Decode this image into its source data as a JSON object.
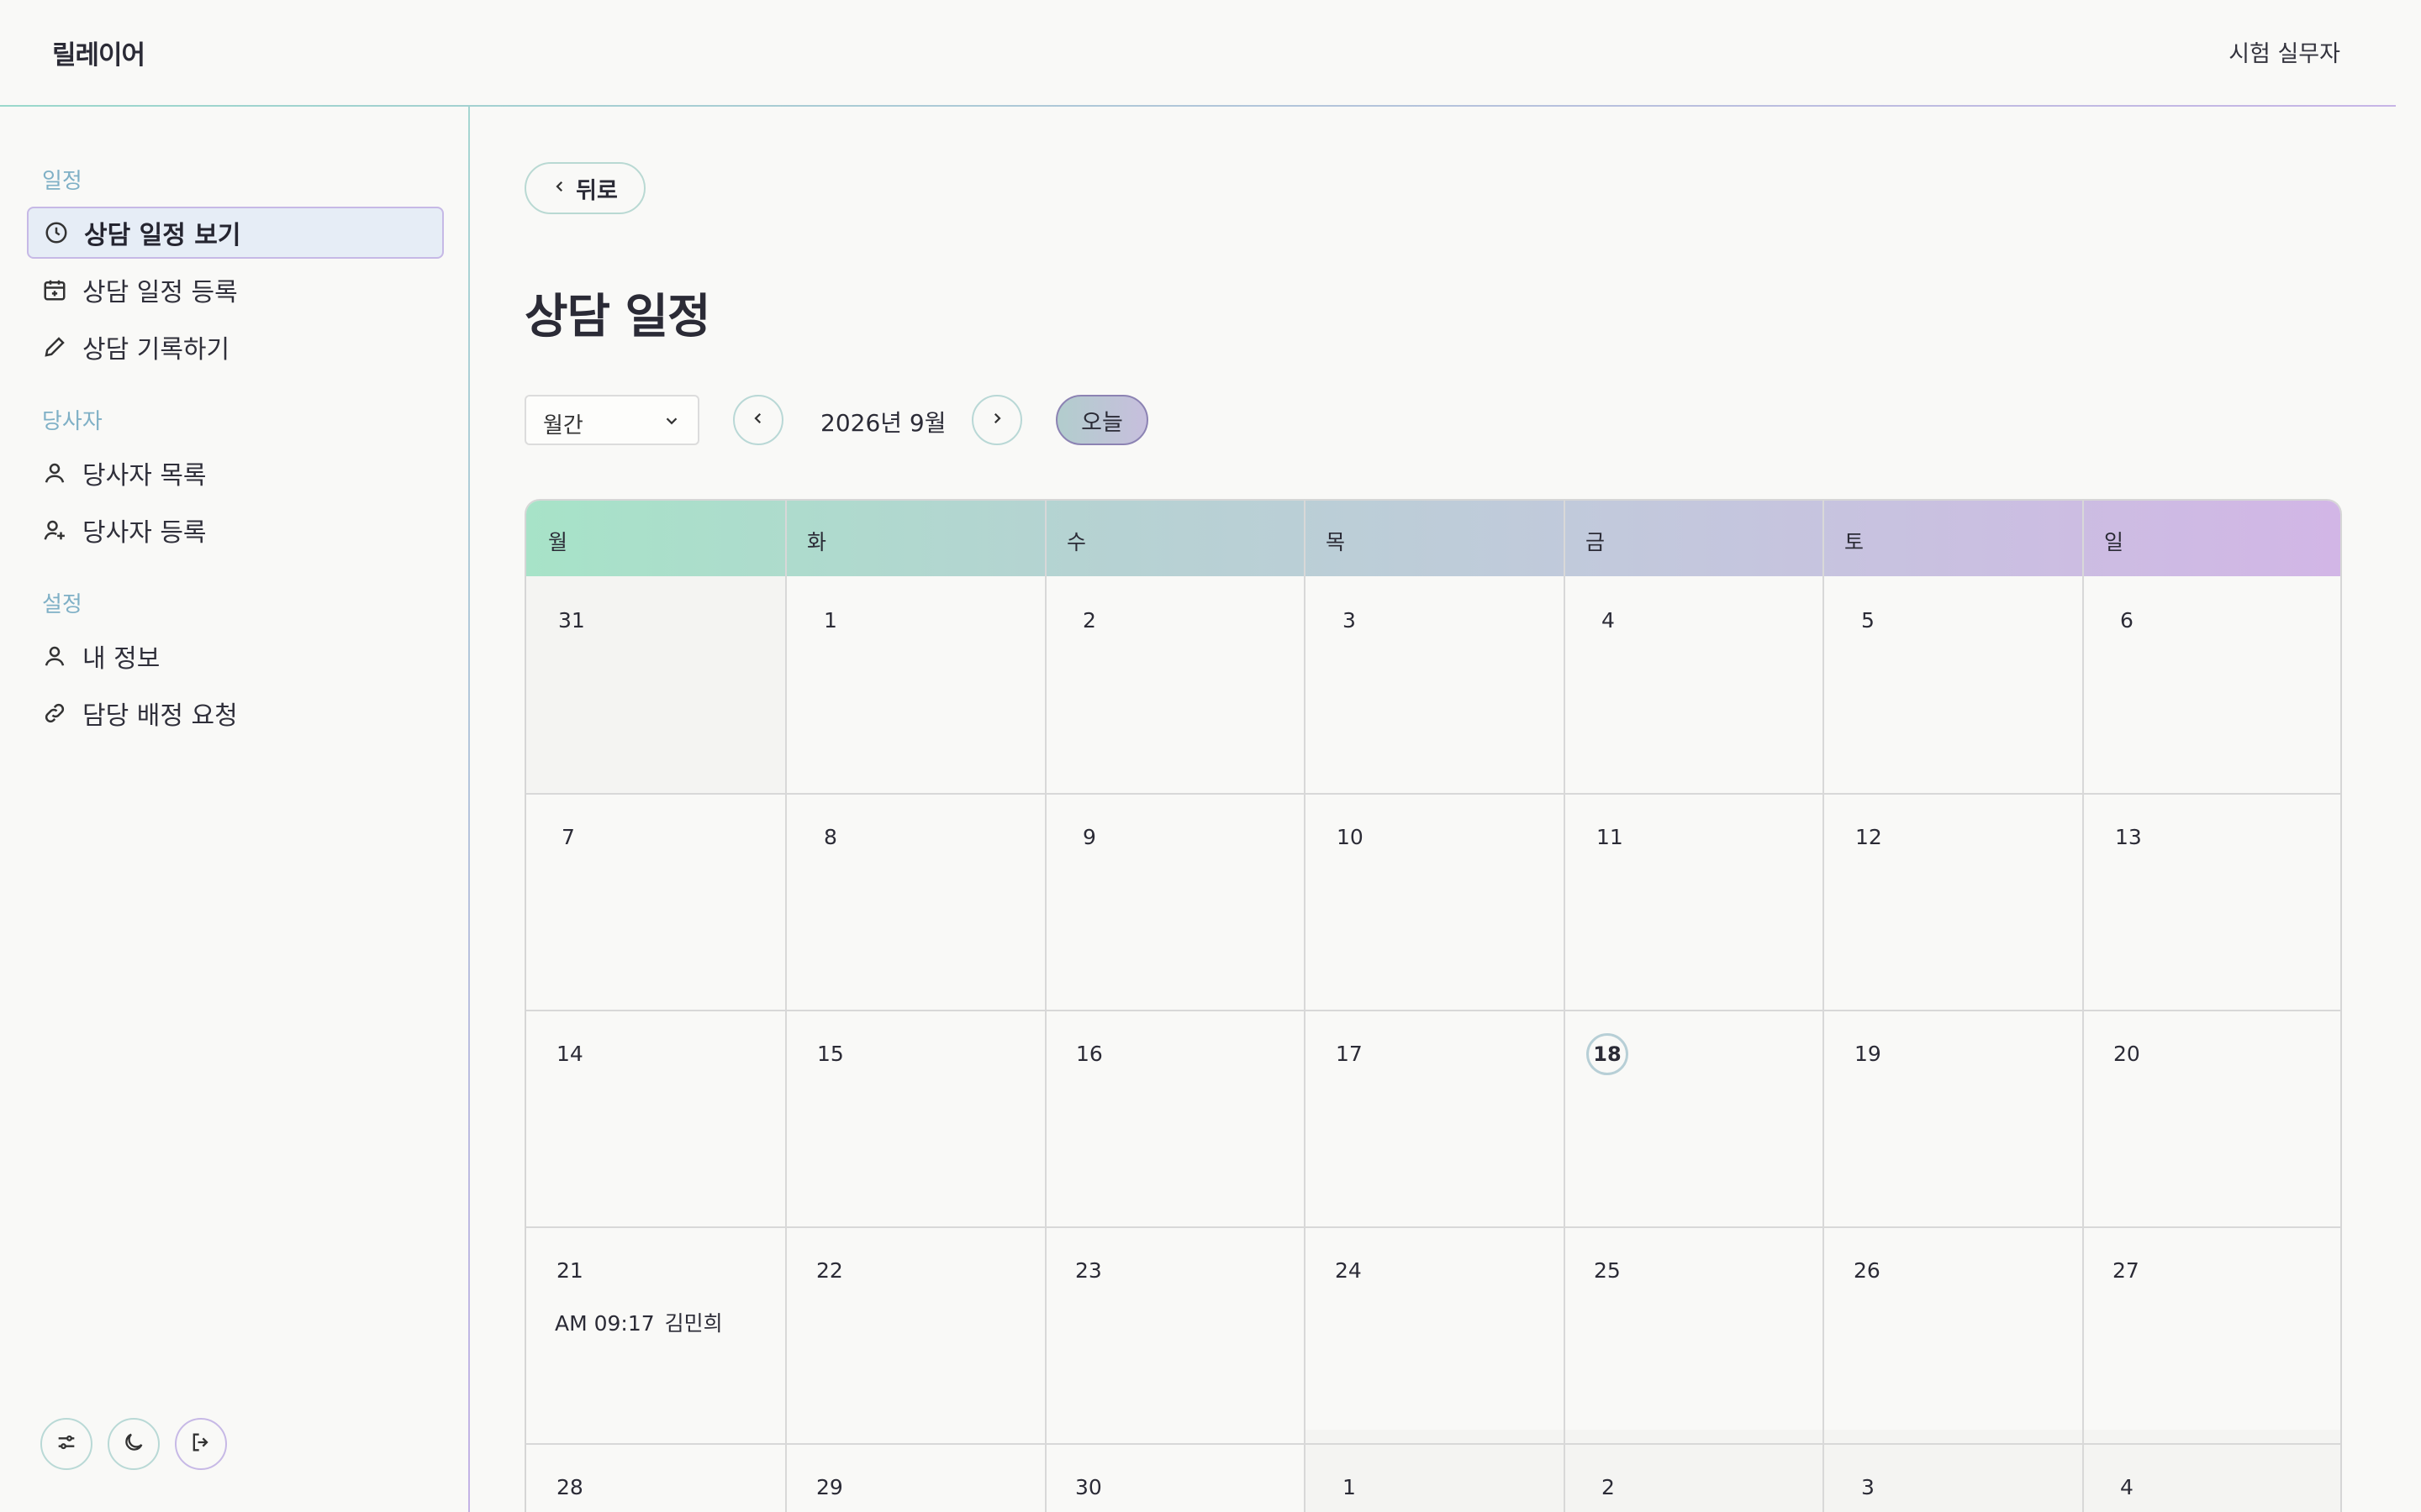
{
  "app": {
    "brand": "릴레이어",
    "user": "시험 실무자"
  },
  "sidebar": {
    "sections": [
      {
        "label": "일정"
      },
      {
        "label": "당사자"
      },
      {
        "label": "설정"
      }
    ],
    "items": [
      {
        "label": "상담 일정 보기",
        "icon": "clock-icon",
        "active": true
      },
      {
        "label": "상담 일정 등록",
        "icon": "calendar-plus-icon"
      },
      {
        "label": "상담 기록하기",
        "icon": "pencil-icon"
      },
      {
        "label": "당사자 목록",
        "icon": "user-icon"
      },
      {
        "label": "당사자 등록",
        "icon": "user-plus-icon"
      },
      {
        "label": "내 정보",
        "icon": "user-icon"
      },
      {
        "label": "담당 배정 요청",
        "icon": "link-icon"
      }
    ],
    "footer_buttons": [
      "sliders-icon",
      "moon-icon",
      "logout-icon"
    ]
  },
  "main": {
    "back_label": "뒤로",
    "title": "상담 일정",
    "view_select": {
      "value": "월간"
    },
    "month_label": "2026년 9월",
    "today_label": "오늘"
  },
  "calendar": {
    "weekdays": [
      "월",
      "화",
      "수",
      "목",
      "금",
      "토",
      "일"
    ],
    "weeks": [
      [
        "31",
        "1",
        "2",
        "3",
        "4",
        "5",
        "6"
      ],
      [
        "7",
        "8",
        "9",
        "10",
        "11",
        "12",
        "13"
      ],
      [
        "14",
        "15",
        "16",
        "17",
        "18",
        "19",
        "20"
      ],
      [
        "21",
        "22",
        "23",
        "24",
        "25",
        "26",
        "27"
      ],
      [
        "28",
        "29",
        "30",
        "1",
        "2",
        "3",
        "4"
      ]
    ],
    "today": "18",
    "events": [
      {
        "day": "21",
        "time": "AM 09:17",
        "name": "김민희"
      }
    ]
  }
}
